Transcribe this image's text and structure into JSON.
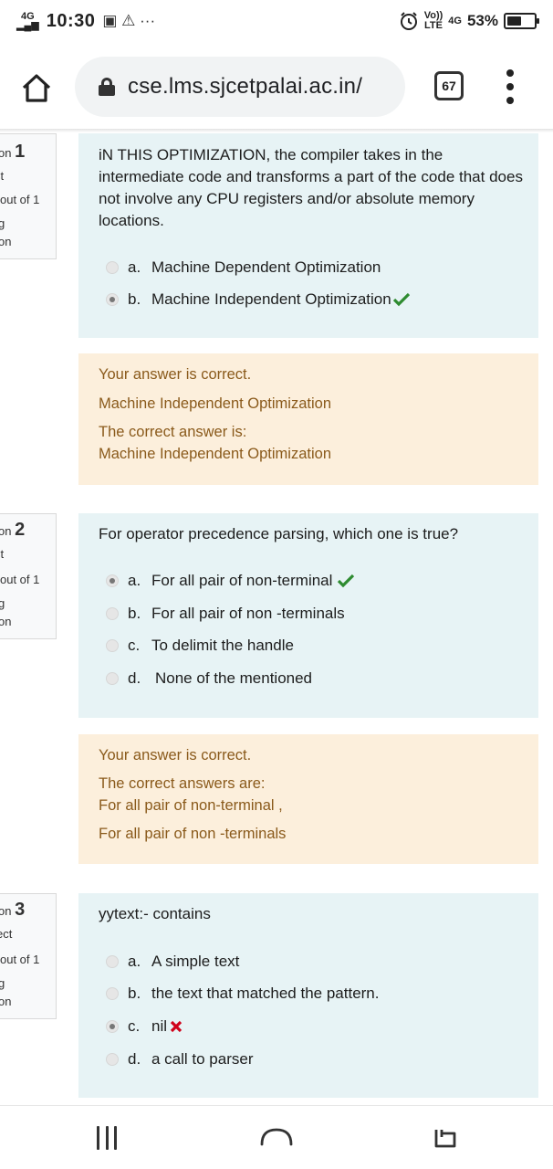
{
  "status_bar": {
    "network": "4G",
    "time": "10:30",
    "notification_icons": "▣ ⚠ ···",
    "volte": "Vo))",
    "lte": "LTE",
    "network_right": "4G",
    "battery_percent": "53%",
    "battery_level": 0.53
  },
  "browser": {
    "url": "cse.lms.sjcetpalai.ac.in/",
    "tab_count": "67"
  },
  "questions": [
    {
      "qno_prefix": "on",
      "qno": "1",
      "status": "ct",
      "mark": "out of 1",
      "flag": "g",
      "flag2": "on",
      "text": "iN THIS OPTIMIZATION, the compiler takes in the intermediate code and transforms a part of the code that does not involve any CPU registers and/or absolute memory locations.",
      "options": [
        {
          "letter": "a.",
          "text": "Machine Dependent Optimization",
          "selected": false,
          "mark": ""
        },
        {
          "letter": "b.",
          "text": "Machine Independent Optimization",
          "selected": true,
          "mark": "correct"
        }
      ],
      "feedback": [
        "Your answer is correct.",
        "Machine Independent Optimization",
        "The correct answer is:",
        "Machine Independent Optimization"
      ]
    },
    {
      "qno_prefix": "on",
      "qno": "2",
      "status": "ct",
      "mark": "out of 1",
      "flag": "g",
      "flag2": "on",
      "text": "For operator precedence parsing, which one is true?",
      "options": [
        {
          "letter": "a.",
          "text": "For all pair of non-terminal",
          "selected": true,
          "mark": "correct"
        },
        {
          "letter": "b.",
          "text": "For all pair of non -terminals",
          "selected": false,
          "mark": ""
        },
        {
          "letter": "c.",
          "text": "To delimit the handle",
          "selected": false,
          "mark": ""
        },
        {
          "letter": "d.",
          "text": "None of the mentioned",
          "selected": false,
          "mark": ""
        }
      ],
      "feedback": [
        "Your answer is correct.",
        "The correct answers are:",
        "For all pair of non-terminal ,",
        "For all pair of non -terminals"
      ]
    },
    {
      "qno_prefix": "on",
      "qno": "3",
      "status": "ect",
      "mark": "out of 1",
      "flag": "g",
      "flag2": "on",
      "text": "yytext:- contains",
      "options": [
        {
          "letter": "a.",
          "text": "A simple text",
          "selected": false,
          "mark": ""
        },
        {
          "letter": "b.",
          "text": "the text that matched the pattern.",
          "selected": false,
          "mark": ""
        },
        {
          "letter": "c.",
          "text": "nil",
          "selected": true,
          "mark": "incorrect"
        },
        {
          "letter": "d.",
          "text": "a call to parser",
          "selected": false,
          "mark": ""
        }
      ]
    }
  ],
  "icons": {
    "home": "home-icon",
    "lock": "lock-icon",
    "menu": "more-vert-icon",
    "correct": "check-icon",
    "incorrect": "cross-icon",
    "nav_recents": "recents-icon",
    "nav_home": "nav-home-icon",
    "nav_back": "back-icon"
  },
  "colors": {
    "question_bg": "#e7f3f5",
    "feedback_bg": "#fcefdc",
    "feedback_text": "#8a5a1b",
    "correct": "#2e8b30",
    "incorrect": "#d0021b"
  }
}
